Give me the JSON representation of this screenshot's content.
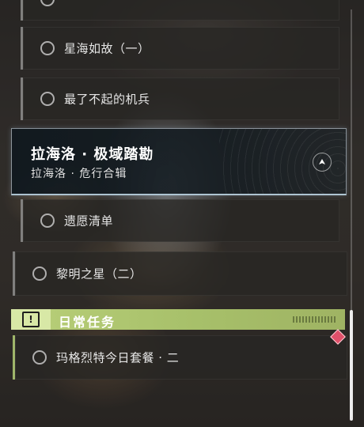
{
  "quest_groups": [
    {
      "items": [
        {
          "label": "星海如故（一）"
        },
        {
          "label": "最了不起的机兵"
        }
      ]
    },
    {
      "selected": {
        "title": "拉海洛 · 极域踏勘",
        "subtitle": "拉海洛 · 危行合辑"
      }
    },
    {
      "items": [
        {
          "label": "遗愿清单"
        },
        {
          "label": "黎明之星（二）"
        }
      ]
    }
  ],
  "daily": {
    "header_label": "日常任务",
    "items": [
      {
        "label": "玛格烈特今日套餐 · 二"
      }
    ]
  },
  "colors": {
    "daily_accent": "#b9cf79",
    "alert": "#e0506a"
  },
  "icons": {
    "task_status": "circle-outline",
    "daily_header": "exclamation-icon",
    "nav": "navigation-arrow-icon",
    "alert": "diamond-alert-icon"
  }
}
